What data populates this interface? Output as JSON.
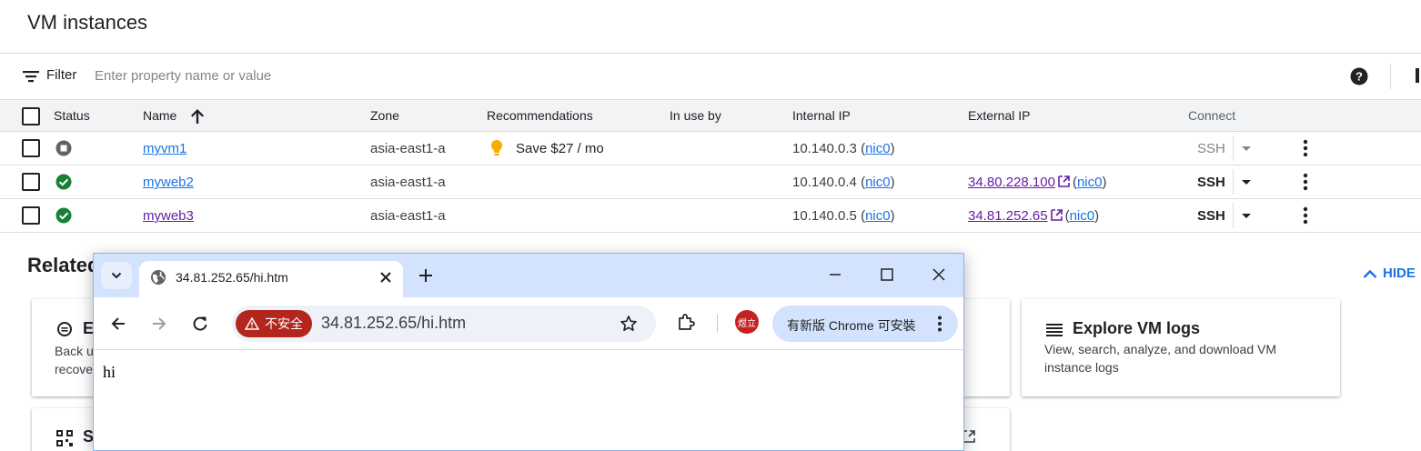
{
  "page": {
    "title": "VM instances"
  },
  "filter": {
    "label": "Filter",
    "placeholder": "Enter property name or value"
  },
  "table": {
    "columns": [
      "Status",
      "Name",
      "Zone",
      "Recommendations",
      "In use by",
      "Internal IP",
      "External IP",
      "Connect"
    ],
    "rows": [
      {
        "status": "stopped",
        "name": "myvm1",
        "zone": "asia-east1-a",
        "recommendation": "Save $27 / mo",
        "in_use_by": "",
        "internal_ip": "10.140.0.3",
        "internal_nic": "nic0",
        "external_ip": "",
        "external_nic": "",
        "connect": "SSH"
      },
      {
        "status": "running",
        "name": "myweb2",
        "zone": "asia-east1-a",
        "recommendation": "",
        "in_use_by": "",
        "internal_ip": "10.140.0.4",
        "internal_nic": "nic0",
        "external_ip": "34.80.228.100",
        "external_nic": "nic0",
        "connect": "SSH"
      },
      {
        "status": "running",
        "name": "myweb3",
        "zone": "asia-east1-a",
        "recommendation": "",
        "in_use_by": "",
        "internal_ip": "10.140.0.5",
        "internal_nic": "nic0",
        "external_ip": "34.81.252.65",
        "external_nic": "nic0",
        "connect": "SSH"
      }
    ]
  },
  "related": {
    "title": "Related",
    "hide_label": "HIDE",
    "cards": [
      {
        "title": "E",
        "desc_line1": "Back u",
        "desc_line2": "recove"
      },
      {
        "title": "Explore VM logs",
        "desc_line1": "View, search, analyze, and download VM",
        "desc_line2": "instance logs"
      },
      {
        "title": "S"
      }
    ]
  },
  "browser": {
    "tab_title": "34.81.252.65/hi.htm",
    "security_label": "不安全",
    "url": "34.81.252.65/hi.htm",
    "avatar_label": "煜立",
    "update_label": "有新版 Chrome 可安裝",
    "page_text": "hi"
  },
  "colors": {
    "accent": "#1a73e8",
    "visited": "#681da8",
    "running": "#188038",
    "insecure": "#b3261e",
    "bulb": "#f9ab00"
  }
}
